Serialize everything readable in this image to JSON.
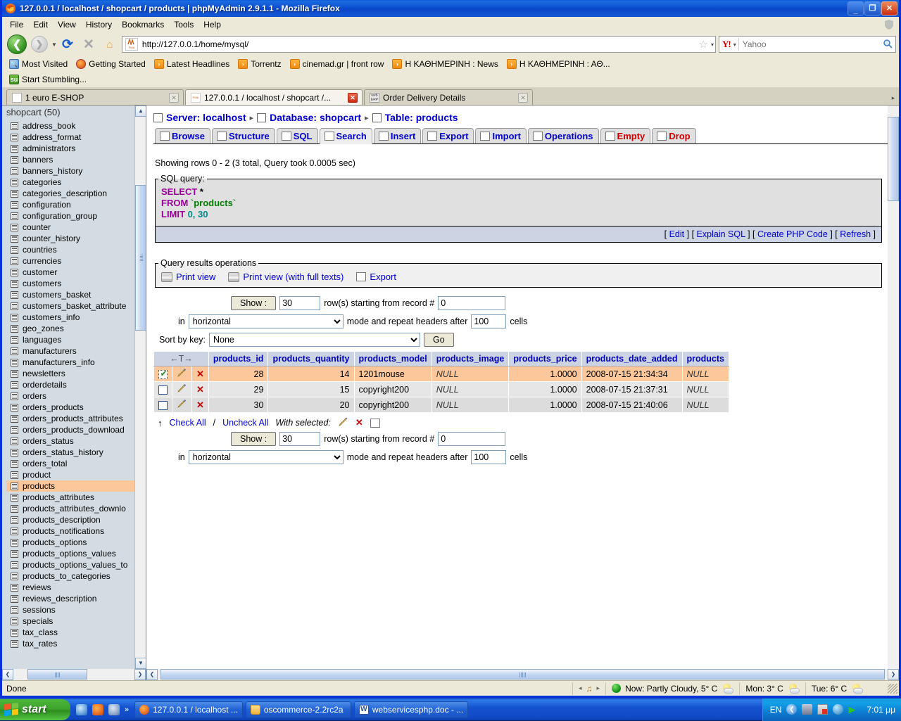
{
  "window": {
    "title": "127.0.0.1 / localhost / shopcart / products | phpMyAdmin 2.9.1.1 - Mozilla Firefox",
    "minimize_label": "_",
    "maximize_label": "❐",
    "close_label": "✕"
  },
  "menubar": {
    "items": [
      "File",
      "Edit",
      "View",
      "History",
      "Bookmarks",
      "Tools",
      "Help"
    ]
  },
  "toolbar": {
    "back_label": "❮",
    "forward_label": "❯",
    "dropdown_label": "▼",
    "reload_label": "⟳",
    "stop_label": "✕",
    "home_label": "⌂",
    "url_value": "http://127.0.0.1/home/mysql/",
    "favicon_label": "PMA",
    "bookmark_star_label": "☆",
    "urlbar_caret_label": "▾",
    "search_engine_label": "Y!",
    "search_engine_caret": "▾",
    "search_placeholder": "Yahoo",
    "search_value": "",
    "search_icon_label": "🔍"
  },
  "bookmarks": {
    "row1": [
      {
        "label": "Most Visited",
        "icon": "globe-icon"
      },
      {
        "label": "Getting Started",
        "icon": "firefox-icon"
      },
      {
        "label": "Latest Headlines",
        "icon": "rss-icon"
      },
      {
        "label": "Torrentz",
        "icon": "rss-icon"
      },
      {
        "label": "cinemad.gr | front row",
        "icon": "rss-icon"
      },
      {
        "label": "Η ΚΑΘΗΜΕΡΙΝΗ : News",
        "icon": "rss-icon"
      },
      {
        "label": "Η ΚΑΘΗΜΕΡΙΝΗ : ΑΘ...",
        "icon": "rss-icon"
      }
    ],
    "row2": [
      {
        "label": "Start Stumbling...",
        "icon": "stumbleupon-icon"
      }
    ]
  },
  "tabs": {
    "items": [
      {
        "label": "1 euro E-SHOP",
        "active": false,
        "icon": "page-icon",
        "close": "✕"
      },
      {
        "label": "127.0.0.1 / localhost / shopcart /...",
        "active": true,
        "icon": "pma-icon",
        "close": "✕"
      },
      {
        "label": "Order Delivery Details",
        "active": false,
        "icon": "web-icon",
        "close": "✕"
      }
    ],
    "scroll_right_label": "▸"
  },
  "sidebar": {
    "database_label": "shopcart (50)",
    "scroll_up_label": "▲",
    "scroll_down_label": "▼",
    "scroll_left_label": "❮",
    "scroll_right_label": "❯",
    "tables": [
      "address_book",
      "address_format",
      "administrators",
      "banners",
      "banners_history",
      "categories",
      "categories_description",
      "configuration",
      "configuration_group",
      "counter",
      "counter_history",
      "countries",
      "currencies",
      "customer",
      "customers",
      "customers_basket",
      "customers_basket_attribute",
      "customers_info",
      "geo_zones",
      "languages",
      "manufacturers",
      "manufacturers_info",
      "newsletters",
      "orderdetails",
      "orders",
      "orders_products",
      "orders_products_attributes",
      "orders_products_download",
      "orders_status",
      "orders_status_history",
      "orders_total",
      "product",
      "products",
      "products_attributes",
      "products_attributes_downlo",
      "products_description",
      "products_notifications",
      "products_options",
      "products_options_values",
      "products_options_values_to",
      "products_to_categories",
      "reviews",
      "reviews_description",
      "sessions",
      "specials",
      "tax_class",
      "tax_rates"
    ],
    "selected_table": "products"
  },
  "breadcrumb": {
    "server": "Server: localhost",
    "database": "Database: shopcart",
    "table": "Table: products",
    "separator": "▸"
  },
  "pma_tabs": [
    {
      "label": "Browse",
      "active": false,
      "danger": false,
      "icon": "browse-icon"
    },
    {
      "label": "Structure",
      "active": false,
      "danger": false,
      "icon": "structure-icon"
    },
    {
      "label": "SQL",
      "active": false,
      "danger": false,
      "icon": "sql-icon"
    },
    {
      "label": "Search",
      "active": true,
      "danger": false,
      "icon": "search-icon"
    },
    {
      "label": "Insert",
      "active": false,
      "danger": false,
      "icon": "insert-icon"
    },
    {
      "label": "Export",
      "active": false,
      "danger": false,
      "icon": "export-icon"
    },
    {
      "label": "Import",
      "active": false,
      "danger": false,
      "icon": "import-icon"
    },
    {
      "label": "Operations",
      "active": false,
      "danger": false,
      "icon": "operations-icon"
    },
    {
      "label": "Empty",
      "active": false,
      "danger": true,
      "icon": "empty-icon"
    },
    {
      "label": "Drop",
      "active": false,
      "danger": true,
      "icon": "drop-icon"
    }
  ],
  "results_summary": "Showing rows 0 - 2 (3 total, Query took 0.0005 sec)",
  "sql_query": {
    "legend": "SQL query:",
    "line1_kw": "SELECT",
    "line1_rest": "*",
    "line2_kw": "FROM",
    "line2_rest": "`products`",
    "line3_kw": "LIMIT",
    "line3_a": "0",
    "line3_comma": ",",
    "line3_b": "30",
    "actions": [
      "Edit",
      "Explain SQL",
      "Create PHP Code",
      "Refresh"
    ],
    "bracket_open": "[",
    "bracket_close": "]"
  },
  "query_results_operations": {
    "legend": "Query results operations",
    "items": [
      {
        "label": "Print view",
        "icon": "printer-icon"
      },
      {
        "label": "Print view (with full texts)",
        "icon": "printer-icon"
      },
      {
        "label": "Export",
        "icon": "export-icon"
      }
    ]
  },
  "nav_controls_top": {
    "show_button": "Show :",
    "rows_value": "30",
    "rows_text": "row(s) starting from record #",
    "start_value": "0",
    "in_label": "in",
    "mode_value": "horizontal",
    "mode_text": "mode and repeat headers after",
    "headers_value": "100",
    "cells_label": "cells",
    "sort_label": "Sort by key:",
    "sort_value": "None",
    "go_button": "Go"
  },
  "nav_controls_bottom": {
    "show_button": "Show :",
    "rows_value": "30",
    "rows_text": "row(s) starting from record #",
    "start_value": "0",
    "in_label": "in",
    "mode_value": "horizontal",
    "mode_text": "mode and repeat headers after",
    "headers_value": "100",
    "cells_label": "cells"
  },
  "table_data": {
    "sort_header": "←T→",
    "columns": [
      "products_id",
      "products_quantity",
      "products_model",
      "products_image",
      "products_price",
      "products_date_added",
      "products"
    ],
    "rows": [
      {
        "checked": true,
        "edit_icon": "✎",
        "delete_icon": "✕",
        "products_id": "28",
        "products_quantity": "14",
        "products_model": "1201mouse",
        "products_image": "NULL",
        "products_price": "1.0000",
        "products_date_added": "2008-07-15 21:34:34",
        "products_last": "NULL"
      },
      {
        "checked": false,
        "edit_icon": "✎",
        "delete_icon": "✕",
        "products_id": "29",
        "products_quantity": "15",
        "products_model": "copyright200",
        "products_image": "NULL",
        "products_price": "1.0000",
        "products_date_added": "2008-07-15 21:37:31",
        "products_last": "NULL"
      },
      {
        "checked": false,
        "edit_icon": "✎",
        "delete_icon": "✕",
        "products_id": "30",
        "products_quantity": "20",
        "products_model": "copyright200",
        "products_image": "NULL",
        "products_price": "1.0000",
        "products_date_added": "2008-07-15 21:40:06",
        "products_last": "NULL"
      }
    ]
  },
  "with_selected": {
    "arrow": "↑",
    "check_all": "Check All",
    "slash": "/",
    "uncheck_all": "Uncheck All",
    "label": "With selected:",
    "edit_icon": "✎",
    "delete_icon": "✕",
    "export_icon": "export-icon"
  },
  "statusbar": {
    "status_text": "Done",
    "media_prev": "◂",
    "media_note": "♫",
    "media_next": "▸",
    "weather_now": "Now: Partly Cloudy, 5° C",
    "weather_mon": "Mon: 3° C",
    "weather_tue": "Tue: 6° C"
  },
  "taskbar": {
    "start_label": "start",
    "quicklaunch_chevron": "»",
    "buttons": [
      {
        "label": "127.0.0.1 / localhost ...",
        "icon": "firefox-icon",
        "active": true
      },
      {
        "label": "oscommerce-2.2rc2a",
        "icon": "folder-icon",
        "active": false
      },
      {
        "label": "webservicesphp.doc - ...",
        "icon": "word-icon",
        "active": false
      }
    ],
    "lang": "EN",
    "clock": "7:01 μμ"
  },
  "colors": {
    "accent_blue": "#0831d9",
    "link_blue": "#0000cc",
    "danger_red": "#cc0000",
    "marked_row": "#fcc89b",
    "header_bg": "#ccd4e4",
    "sidebar_bg": "#d3dce3"
  }
}
